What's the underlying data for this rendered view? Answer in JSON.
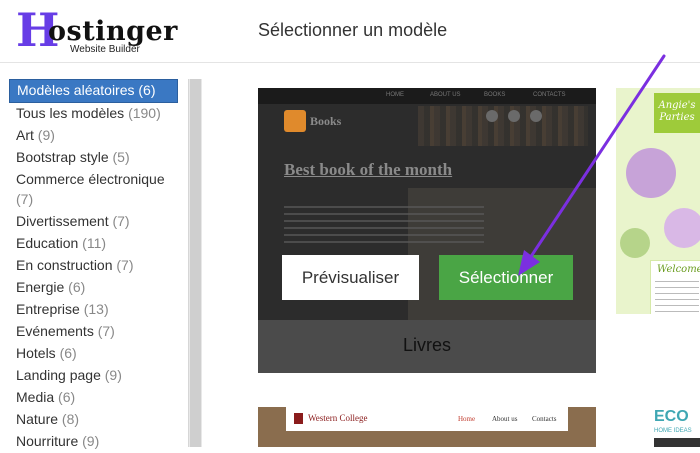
{
  "app": {
    "logo_initial": "H",
    "logo_word": "ostinger",
    "logo_subtitle": "Website Builder",
    "page_title": "Sélectionner un modèle"
  },
  "sidebar": {
    "categories": [
      {
        "label": "Modèles aléatoires (6)",
        "count": "",
        "active": true
      },
      {
        "label": "Tous les modèles",
        "count": "(190)"
      },
      {
        "label": "Art",
        "count": "(9)"
      },
      {
        "label": "Bootstrap style",
        "count": "(5)"
      },
      {
        "label": "Commerce électronique",
        "count": "(7)"
      },
      {
        "label": "Divertissement",
        "count": "(7)"
      },
      {
        "label": "Education",
        "count": "(11)"
      },
      {
        "label": "En construction",
        "count": "(7)"
      },
      {
        "label": "Energie",
        "count": "(6)"
      },
      {
        "label": "Entreprise",
        "count": "(13)"
      },
      {
        "label": "Evénements",
        "count": "(7)"
      },
      {
        "label": "Hotels",
        "count": "(6)"
      },
      {
        "label": "Landing page",
        "count": "(9)"
      },
      {
        "label": "Media",
        "count": "(6)"
      },
      {
        "label": "Nature",
        "count": "(8)"
      },
      {
        "label": "Nourriture",
        "count": "(9)"
      }
    ]
  },
  "templates": {
    "books": {
      "nav": [
        "HOME",
        "ABOUT US",
        "BOOKS",
        "CONTACTS"
      ],
      "brand": "Books",
      "heading": "Best book of the month",
      "preview_label": "Prévisualiser",
      "select_label": "Sélectionner",
      "name": "Livres"
    },
    "party": {
      "title_line1": "Angie's",
      "title_line2": "Parties",
      "welcome": "Welcome"
    },
    "college": {
      "brand": "Western College",
      "nav": [
        "Home",
        "About us",
        "Contacts"
      ]
    },
    "eco": {
      "logo": "ECO",
      "subtitle": "HOME IDEAS"
    }
  },
  "colors": {
    "brand_purple": "#673de6",
    "active_category": "#3a78c3",
    "select_green": "#4aa545",
    "annotation_arrow": "#7b2fe0"
  },
  "icons": {
    "book_logo": "book-icon",
    "social": [
      "facebook-icon",
      "twitter-icon",
      "google-plus-icon"
    ]
  }
}
